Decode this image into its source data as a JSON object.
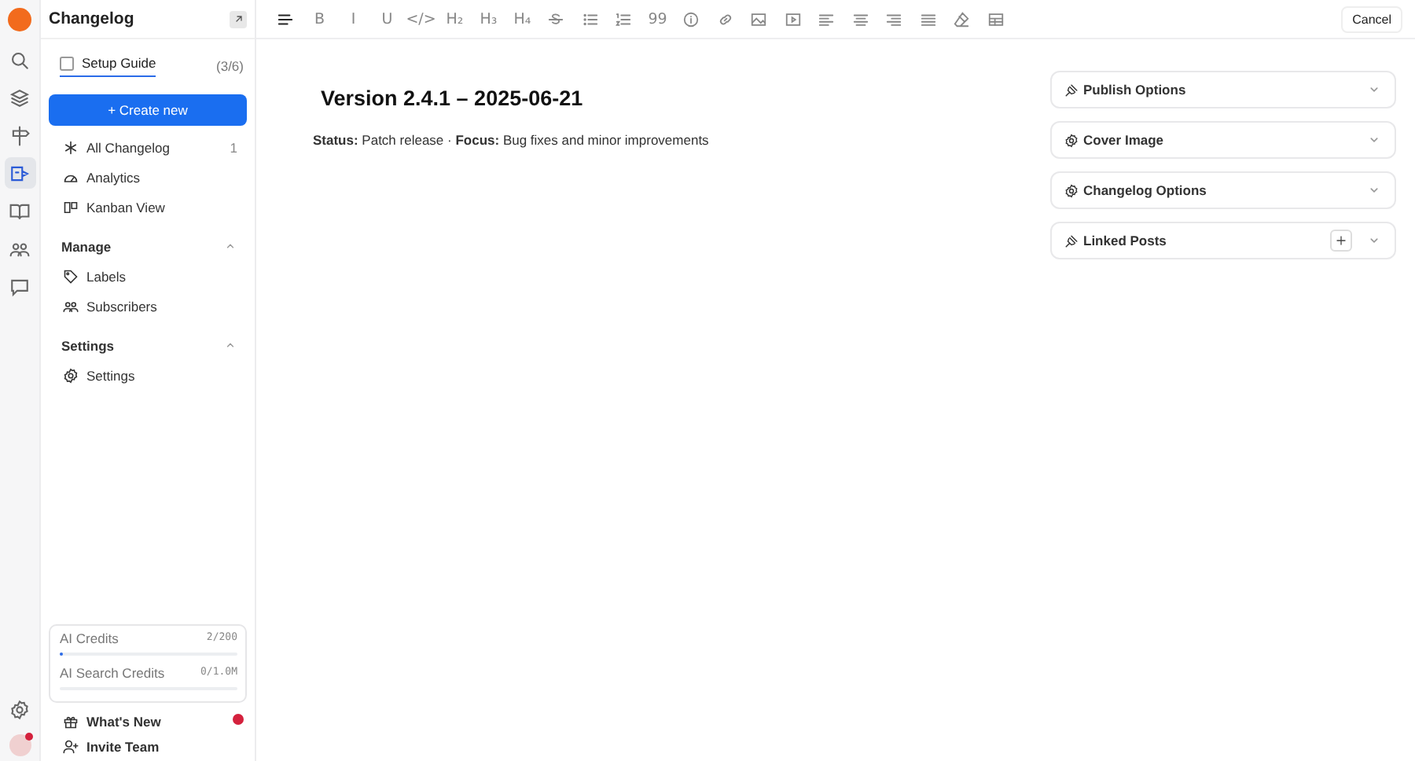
{
  "rail": {
    "items": [
      {
        "selected": false
      },
      {
        "selected": false
      },
      {
        "selected": false
      },
      {
        "selected": true
      },
      {
        "selected": false
      },
      {
        "selected": false
      },
      {
        "selected": false
      }
    ]
  },
  "sidebar": {
    "title": "Changelog",
    "setup_guide": {
      "label": "Setup Guide",
      "checked": false,
      "progress": "(3/6)"
    },
    "create_button": "+ Create new",
    "nav": [
      {
        "label": "All Changelog",
        "count": "1",
        "selected": false
      },
      {
        "label": "Analytics",
        "selected": false
      },
      {
        "label": "Kanban View",
        "selected": false
      }
    ],
    "sections": [
      {
        "title": "Manage",
        "expanded": true,
        "items": [
          "Labels",
          "Subscribers"
        ]
      },
      {
        "title": "Settings",
        "expanded": true,
        "items": [
          "Settings"
        ]
      }
    ],
    "credits": [
      {
        "label": "AI Credits",
        "reading": "2/200",
        "level": 0.01
      },
      {
        "label": "AI Search Credits",
        "reading": "0/1.0M",
        "level": 0
      }
    ],
    "footer": [
      {
        "label": "What's New",
        "unread": true
      },
      {
        "label": "Invite Team",
        "unread": false
      }
    ]
  },
  "toolbar": [
    {
      "kind": "icon"
    },
    {
      "kind": "glyph",
      "label": "B"
    },
    {
      "kind": "glyph",
      "label": "I"
    },
    {
      "kind": "glyph",
      "label": "U"
    },
    {
      "kind": "glyph",
      "label": "</>"
    },
    {
      "kind": "glyph",
      "label": "H₂"
    },
    {
      "kind": "glyph",
      "label": "H₃"
    },
    {
      "kind": "glyph",
      "label": "H₄"
    },
    {
      "kind": "icon"
    },
    {
      "kind": "icon"
    },
    {
      "kind": "icon"
    },
    {
      "kind": "glyph",
      "label": "99"
    },
    {
      "kind": "icon"
    },
    {
      "kind": "icon"
    },
    {
      "kind": "icon"
    },
    {
      "kind": "icon"
    },
    {
      "kind": "icon"
    },
    {
      "kind": "icon"
    },
    {
      "kind": "icon"
    },
    {
      "kind": "icon"
    },
    {
      "kind": "icon"
    },
    {
      "kind": "icon"
    }
  ],
  "cancel_button": "Cancel",
  "document": {
    "title": "Version 2.4.1 – 2025-06-21",
    "summary": "**Status:** Patch release · **Focus:** Bug fixes and minor improvements"
  },
  "panels": [
    {
      "title": "Publish Options",
      "kind": "plug",
      "expanded": false,
      "addable": false
    },
    {
      "title": "Cover Image",
      "kind": "gear",
      "expanded": false,
      "addable": false
    },
    {
      "title": "Changelog Options",
      "kind": "gear",
      "expanded": false,
      "addable": false
    },
    {
      "title": "Linked Posts",
      "kind": "plug",
      "expanded": false,
      "addable": true
    }
  ]
}
